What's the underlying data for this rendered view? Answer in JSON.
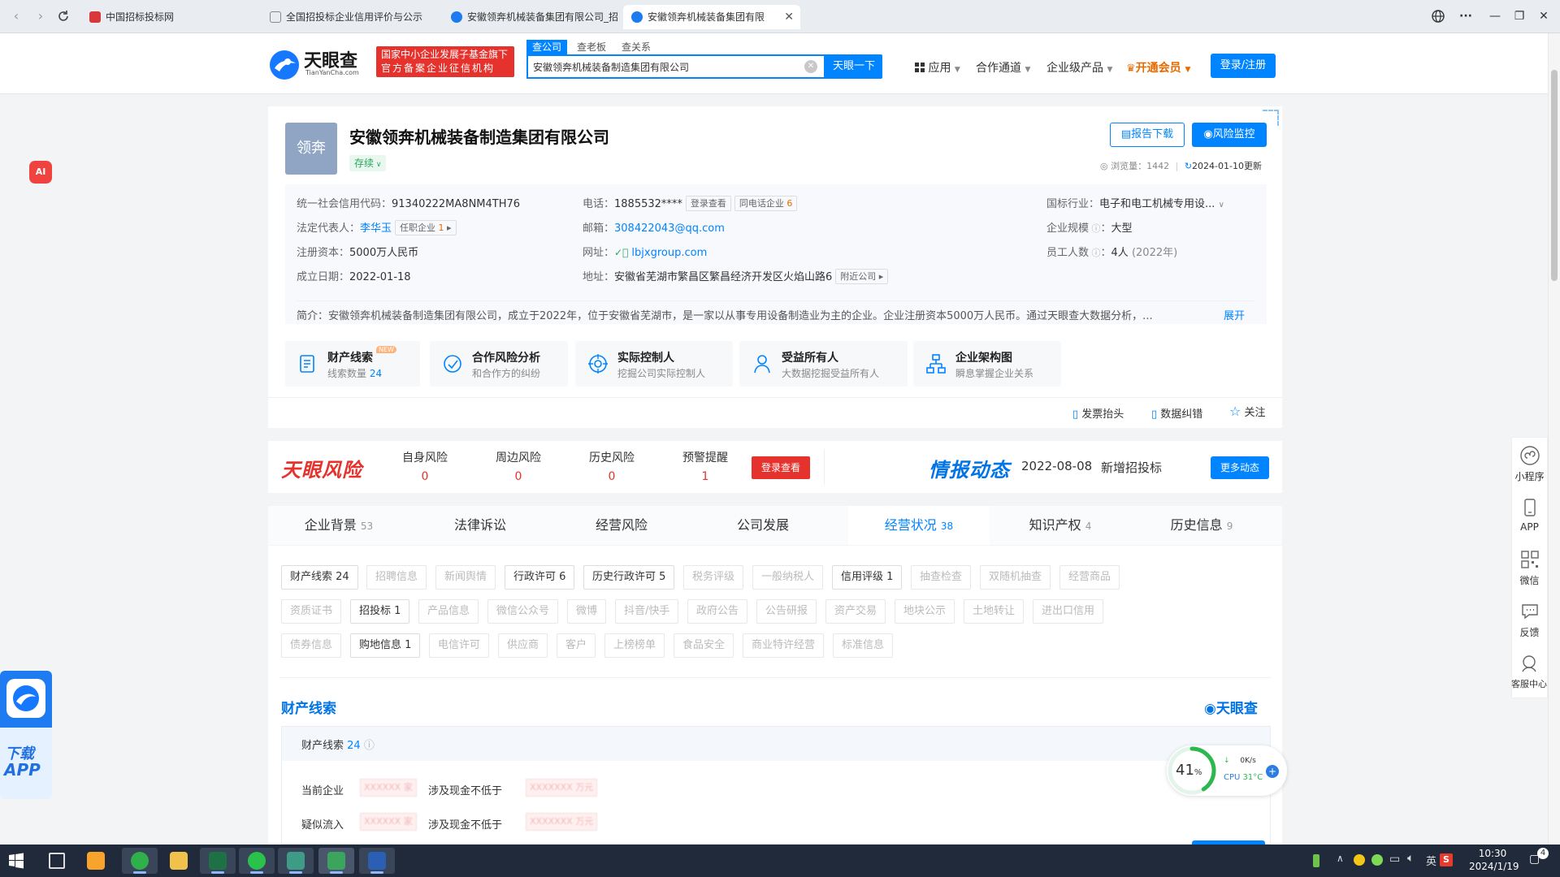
{
  "browser": {
    "tabs": [
      {
        "title": "中国招标投标网",
        "icon_color": "#d9383a"
      },
      {
        "title": "全国招投标企业信用评价与公示",
        "icon_color": "#888888"
      },
      {
        "title": "安徽领奔机械装备集团有限公司_招",
        "icon_color": "#1d7bf2"
      },
      {
        "title": "安徽领奔机械装备集团有限",
        "icon_color": "#1d7bf2"
      }
    ]
  },
  "header": {
    "logo_text": "天眼查",
    "logo_sub": "TianYanCha.com",
    "banner_line1": "国家中小企业发展子基金旗下",
    "banner_line2": "官方备案企业征信机构",
    "search_tabs": [
      "查公司",
      "查老板",
      "查关系"
    ],
    "search_value": "安徽领奔机械装备制造集团有限公司",
    "search_button": "天眼一下",
    "menu": [
      "应用",
      "合作通道",
      "企业级产品",
      "开通会员"
    ],
    "login": "登录/注册"
  },
  "company": {
    "logo_text": "领奔",
    "name": "安徽领奔机械装备制造集团有限公司",
    "status": "存续",
    "report_btn": "报告下载",
    "monitor_btn": "风险监控",
    "views_label": "浏览量：",
    "views": "1442",
    "updated": "2024-01-10更新",
    "info": {
      "credit_code_label": "统一社会信用代码：",
      "credit_code": "91340222MA8NM4TH76",
      "legal_rep_label": "法定代表人：",
      "legal_rep": "李华玉",
      "legal_rep_tag": "任职企业",
      "legal_rep_tag_count": "1",
      "capital_label": "注册资本：",
      "capital": "5000万人民币",
      "founded_label": "成立日期：",
      "founded": "2022-01-18",
      "phone_label": "电话：",
      "phone": "1885532****",
      "phone_tag": "登录查看",
      "same_phone_tag": "同电话企业",
      "same_phone_count": "6",
      "email_label": "邮箱：",
      "email": "308422043@qq.com",
      "website_label": "网址：",
      "website": "lbjxgroup.com",
      "address_label": "地址：",
      "address": "安徽省芜湖市繁昌区繁昌经济开发区火焰山路6",
      "nearby_tag": "附近公司",
      "industry_label": "国标行业：",
      "industry": "电子和电工机械专用设...",
      "scale_label": "企业规模",
      "scale": "大型",
      "staff_label": "员工人数",
      "staff": "4人",
      "staff_year": "(2022年)"
    },
    "intro_label": "简介：",
    "intro": "安徽领奔机械装备制造集团有限公司，成立于2022年，位于安徽省芜湖市，是一家以从事专用设备制造业为主的企业。企业注册资本5000万人民币。通过天眼查大数据分析，...",
    "expand": "展开"
  },
  "features": [
    {
      "title": "财产线索",
      "sub": "线索数量",
      "sub_value": "24",
      "badge": "NEW"
    },
    {
      "title": "合作风险分析",
      "sub": "和合作方的纠纷"
    },
    {
      "title": "实际控制人",
      "sub": "挖掘公司实际控制人"
    },
    {
      "title": "受益所有人",
      "sub": "大数据挖掘受益所有人"
    },
    {
      "title": "企业架构图",
      "sub": "瞬息掌握企业关系"
    }
  ],
  "actions": [
    "发票抬头",
    "数据纠错",
    "关注"
  ],
  "risk": {
    "brand": "天眼风险",
    "items": [
      {
        "label": "自身风险",
        "value": "0"
      },
      {
        "label": "周边风险",
        "value": "0"
      },
      {
        "label": "历史风险",
        "value": "0"
      },
      {
        "label": "预警提醒",
        "value": "1"
      }
    ],
    "login_btn": "登录查看",
    "intel_brand": "情报动态",
    "intel_date": "2022-08-08",
    "intel_text": "新增招投标",
    "more_btn": "更多动态"
  },
  "nav_tabs": [
    {
      "label": "企业背景",
      "count": "53"
    },
    {
      "label": "法律诉讼",
      "count": ""
    },
    {
      "label": "经营风险",
      "count": ""
    },
    {
      "label": "公司发展",
      "count": ""
    },
    {
      "label": "经营状况",
      "count": "38"
    },
    {
      "label": "知识产权",
      "count": "4"
    },
    {
      "label": "历史信息",
      "count": "9"
    }
  ],
  "chips_row1": [
    "财产线索 24",
    "招聘信息",
    "新闻舆情",
    "行政许可 6",
    "历史行政许可 5",
    "税务评级",
    "一般纳税人",
    "信用评级 1",
    "抽查检查",
    "双随机抽查",
    "经营商品"
  ],
  "chips_row2": [
    "资质证书",
    "招投标 1",
    "产品信息",
    "微信公众号",
    "微博",
    "抖音/快手",
    "政府公告",
    "公告研报",
    "资产交易",
    "地块公示",
    "土地转让",
    "进出口信用"
  ],
  "chips_row3": [
    "债券信息",
    "购地信息 1",
    "电信许可",
    "供应商",
    "客户",
    "上榜榜单",
    "食品安全",
    "商业特许经营",
    "标准信息"
  ],
  "assets": {
    "title": "财产线索",
    "brand": "天眼查",
    "sub_title": "财产线索",
    "sub_count": "24",
    "row1_label": "当前企业",
    "row1_mid": "涉及现金不低于",
    "row2_label": "疑似流入",
    "row2_mid": "涉及现金不低于",
    "blur1": "XXXXXX 家",
    "blur2": "XXXXXXX 万元",
    "blur3": "XXXXXX 家",
    "blur4": "XXXXXXX 万元"
  },
  "left_float": {
    "ai": "AI",
    "download": "下载",
    "app": "APP"
  },
  "right_side": [
    "小程序",
    "APP",
    "微信",
    "反馈",
    "客服中心"
  ],
  "cpu_widget": {
    "percent": "41",
    "unit": "%",
    "net": "0K/s",
    "cpu": "CPU",
    "temp": "31°C"
  },
  "taskbar": {
    "time": "10:30",
    "date": "2024/1/19",
    "lang": "英",
    "notify": "4"
  }
}
